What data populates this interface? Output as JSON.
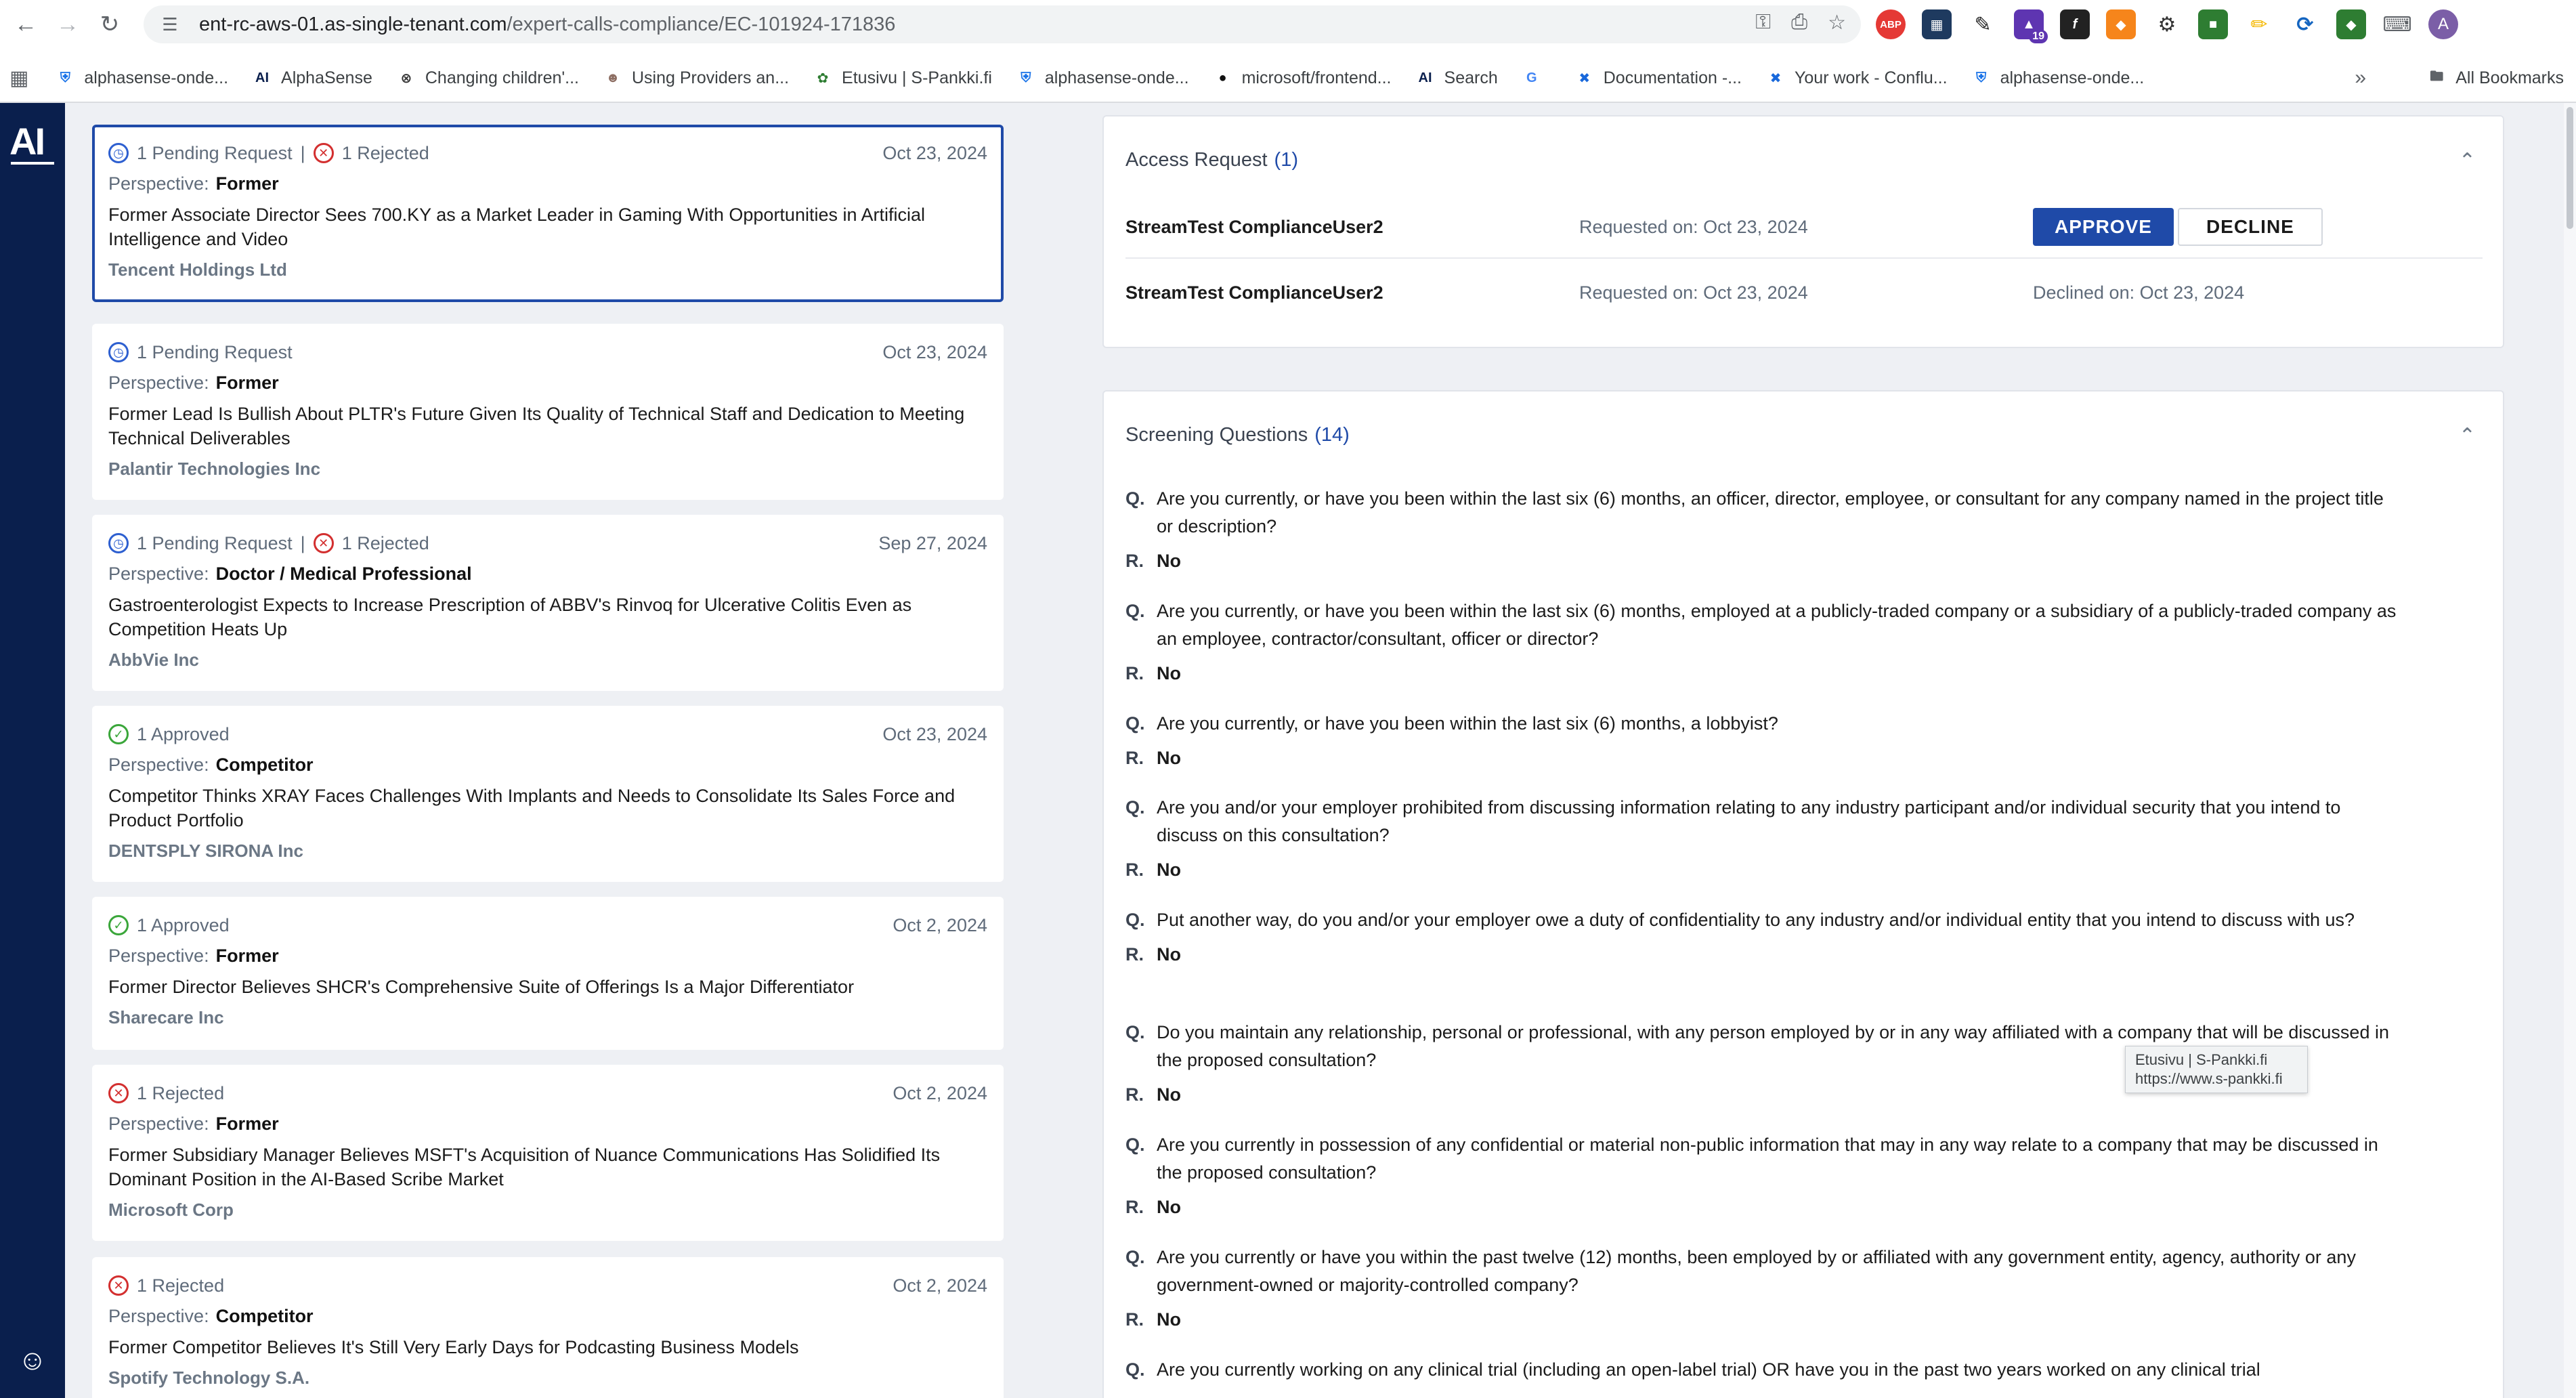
{
  "browser": {
    "url_host": "ent-rc-aws-01.as-single-tenant.com",
    "url_path": "/expert-calls-compliance/EC-101924-171836",
    "extension_badge": "19",
    "profile_initial": "A",
    "bookmarks": [
      {
        "icon": "shield-favicon",
        "label": "alphasense-onde..."
      },
      {
        "icon": "alphasense-favicon",
        "label": "AlphaSense"
      },
      {
        "icon": "circle-x-favicon",
        "label": "Changing children'..."
      },
      {
        "icon": "person-favicon",
        "label": "Using Providers an..."
      },
      {
        "icon": "leaf-favicon",
        "label": "Etusivu | S-Pankki.fi"
      },
      {
        "icon": "shield-favicon",
        "label": "alphasense-onde..."
      },
      {
        "icon": "github-favicon",
        "label": "microsoft/frontend..."
      },
      {
        "icon": "alphasense-favicon",
        "label": "Search"
      },
      {
        "icon": "google-favicon",
        "label": ""
      },
      {
        "icon": "confluence-favicon",
        "label": "Documentation -..."
      },
      {
        "icon": "confluence-favicon",
        "label": "Your work - Conflu..."
      },
      {
        "icon": "shield-favicon",
        "label": "alphasense-onde..."
      }
    ],
    "all_bookmarks": "All Bookmarks",
    "tooltip": {
      "title": "Etusivu | S-Pankki.fi",
      "url": "https://www.s-pankki.fi"
    }
  },
  "app": {
    "logo": "AI"
  },
  "list": {
    "perspective_label": "Perspective:",
    "cards": [
      {
        "status1": "1 Pending Request",
        "status2": "1 Rejected",
        "date": "Oct 23, 2024",
        "perspective": "Former",
        "title": "Former Associate Director Sees 700.KY as a Market Leader in Gaming With Opportunities in Artificial Intelligence and Video",
        "company": "Tencent Holdings Ltd"
      },
      {
        "status1": "1 Pending Request",
        "status2": "",
        "date": "Oct 23, 2024",
        "perspective": "Former",
        "title": "Former Lead Is Bullish About PLTR's Future Given Its Quality of Technical Staff and Dedication to Meeting Technical Deliverables",
        "company": "Palantir Technologies Inc"
      },
      {
        "status1": "1 Pending Request",
        "status2": "1 Rejected",
        "date": "Sep 27, 2024",
        "perspective": "Doctor / Medical Professional",
        "title": "Gastroenterologist Expects to Increase Prescription of ABBV's Rinvoq for Ulcerative Colitis Even as Competition Heats Up",
        "company": "AbbVie Inc"
      },
      {
        "status1": "1 Approved",
        "status2": "",
        "date": "Oct 23, 2024",
        "perspective": "Competitor",
        "title": "Competitor Thinks XRAY Faces Challenges With Implants and Needs to Consolidate Its Sales Force and Product Portfolio",
        "company": "DENTSPLY SIRONA Inc"
      },
      {
        "status1": "1 Approved",
        "status2": "",
        "date": "Oct 2, 2024",
        "perspective": "Former",
        "title": "Former Director Believes SHCR's Comprehensive Suite of Offerings Is a Major Differentiator",
        "company": "Sharecare Inc"
      },
      {
        "status1": "1 Rejected",
        "status2": "",
        "date": "Oct 2, 2024",
        "perspective": "Former",
        "title": "Former Subsidiary Manager Believes MSFT's Acquisition of Nuance Communications Has Solidified Its Dominant Position in the AI-Based Scribe Market",
        "company": "Microsoft Corp"
      },
      {
        "status1": "1 Rejected",
        "status2": "",
        "date": "Oct 2, 2024",
        "perspective": "Competitor",
        "title": "Former Competitor Believes It's Still Very Early Days for Podcasting Business Models",
        "company": "Spotify Technology S.A."
      }
    ]
  },
  "access": {
    "heading": "Access Request",
    "count": "(1)",
    "rows": [
      {
        "name": "StreamTest ComplianceUser2",
        "requested": "Requested on: Oct 23, 2024",
        "approve": "APPROVE",
        "decline": "DECLINE"
      },
      {
        "name": "StreamTest ComplianceUser2",
        "requested": "Requested on: Oct 23, 2024",
        "declined": "Declined on: Oct 23, 2024"
      }
    ]
  },
  "screening": {
    "heading": "Screening Questions",
    "count": "(14)",
    "q_label": "Q.",
    "r_label": "R.",
    "items": [
      {
        "q": "Are you currently, or have you been within the last six (6) months, an officer, director, employee, or consultant for any company named in the project title or description?",
        "r": "No"
      },
      {
        "q": "Are you currently, or have you been within the last six (6) months, employed at a publicly-traded company or a subsidiary of a publicly-traded company as an employee, contractor/consultant, officer or director?",
        "r": "No"
      },
      {
        "q": "Are you currently, or have you been within the last six (6) months, a lobbyist?",
        "r": "No"
      },
      {
        "q": "Are you and/or your employer prohibited from discussing information relating to any industry participant and/or individual security that you intend to discuss on this consultation?",
        "r": "No"
      },
      {
        "q": "Put another way, do you and/or your employer owe a duty of confidentiality to any industry and/or individual entity that you intend to discuss with us?",
        "r": "No"
      },
      {
        "q": "Do you maintain any relationship, personal or professional, with any person employed by or in any way affiliated with a company that will be discussed in the proposed consultation?",
        "r": "No"
      },
      {
        "q": "Are you currently in possession of any confidential or material non-public information that may in any way relate to a company that may be discussed in the proposed consultation?",
        "r": "No"
      },
      {
        "q": "Are you currently or have you within the past twelve (12) months, been employed by or affiliated with any government entity, agency, authority or any government-owned or majority-controlled company?",
        "r": "No"
      },
      {
        "q": "Are you currently working on any clinical trial (including an open-label trial) OR have you in the past two years worked on any clinical trial",
        "r": ""
      }
    ]
  }
}
